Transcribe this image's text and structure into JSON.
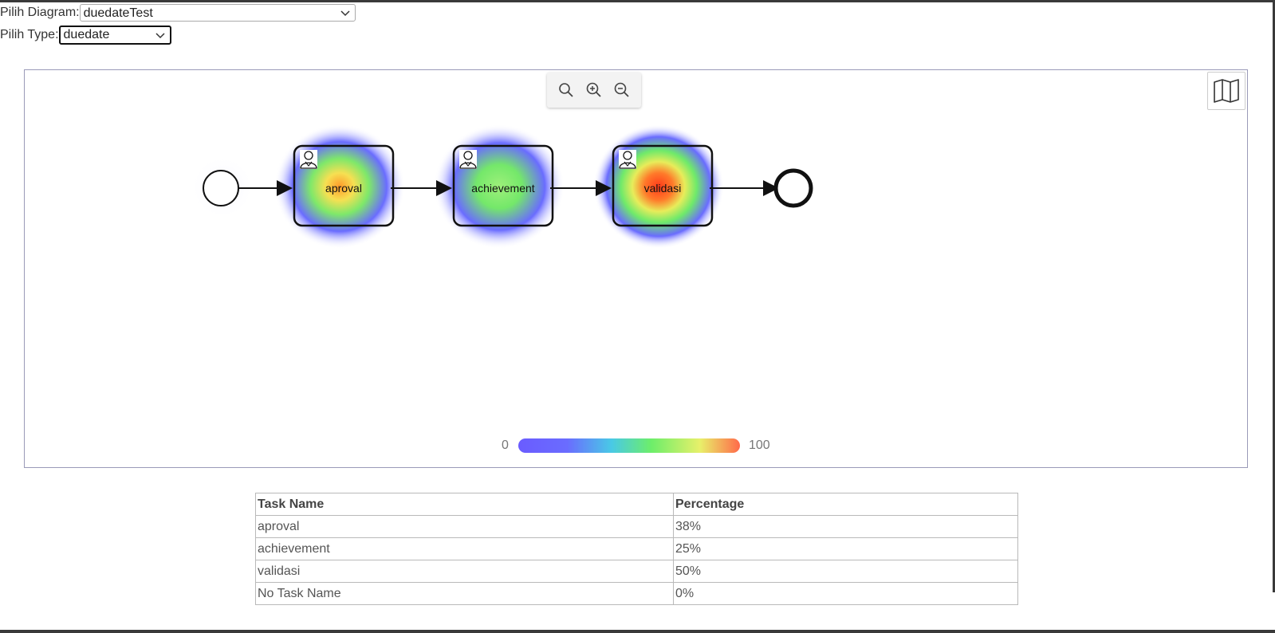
{
  "form": {
    "diagram_label": "Pilih Diagram:",
    "diagram_value": "duedateTest",
    "type_label": "Pilih Type:",
    "type_value": "duedate"
  },
  "diagram": {
    "tasks": [
      {
        "label": "aprova l",
        "heat": "medium"
      },
      {
        "label": "achievement",
        "heat": "low"
      },
      {
        "label": "validasi",
        "heat": "high"
      }
    ]
  },
  "zoom": {
    "icons": [
      "search-icon",
      "zoom-in-icon",
      "zoom-out-icon"
    ],
    "minimap_icon": "map-icon"
  },
  "legend": {
    "min": "0",
    "max": "100"
  },
  "table": {
    "headers": [
      "Task Name",
      "Percentage"
    ],
    "rows": [
      {
        "task": "aproval",
        "pct": "38%"
      },
      {
        "task": "achievement",
        "pct": "25%"
      },
      {
        "task": "validasi",
        "pct": "50%"
      },
      {
        "task": "No Task Name",
        "pct": "0%"
      }
    ]
  },
  "colors": {
    "heat_low": "#6a5cff",
    "heat_mid": "#6dee6a",
    "heat_high": "#ff6a4a"
  }
}
